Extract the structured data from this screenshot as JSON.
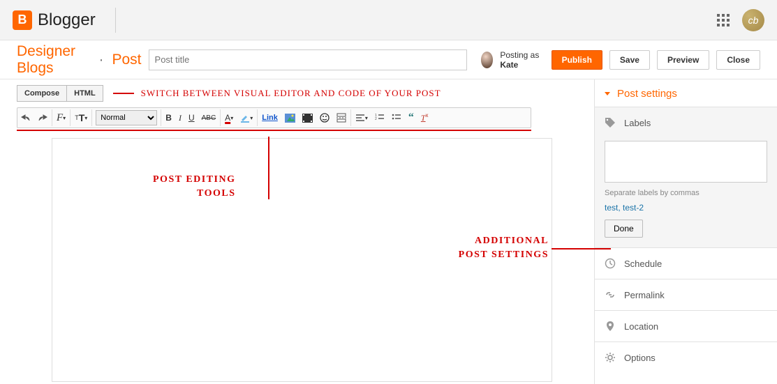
{
  "header": {
    "brand": "Blogger",
    "avatar_initials": "cb"
  },
  "breadcrumb": {
    "blog": "Designer Blogs",
    "dot": "·",
    "section": "Post"
  },
  "title_placeholder": "Post title",
  "posting": {
    "prefix": "Posting as ",
    "name": "Kate"
  },
  "buttons": {
    "publish": "Publish",
    "save": "Save",
    "preview": "Preview",
    "close": "Close"
  },
  "modes": {
    "compose": "Compose",
    "html": "HTML"
  },
  "annotations": {
    "switch_editor": "SWITCH BETWEEN VISUAL  EDITOR AND CODE OF YOUR POST",
    "tools_l1": "POST EDITING",
    "tools_l2": "TOOLS",
    "settings_l1": "ADDITIONAL",
    "settings_l2": "POST SETTINGS"
  },
  "toolbar": {
    "format_value": "Normal",
    "link": "Link"
  },
  "settings": {
    "heading": "Post settings",
    "labels": {
      "title": "Labels",
      "hint": "Separate labels by commas",
      "suggestions": "test, test-2",
      "done": "Done"
    },
    "schedule": "Schedule",
    "permalink": "Permalink",
    "location": "Location",
    "options": "Options"
  }
}
